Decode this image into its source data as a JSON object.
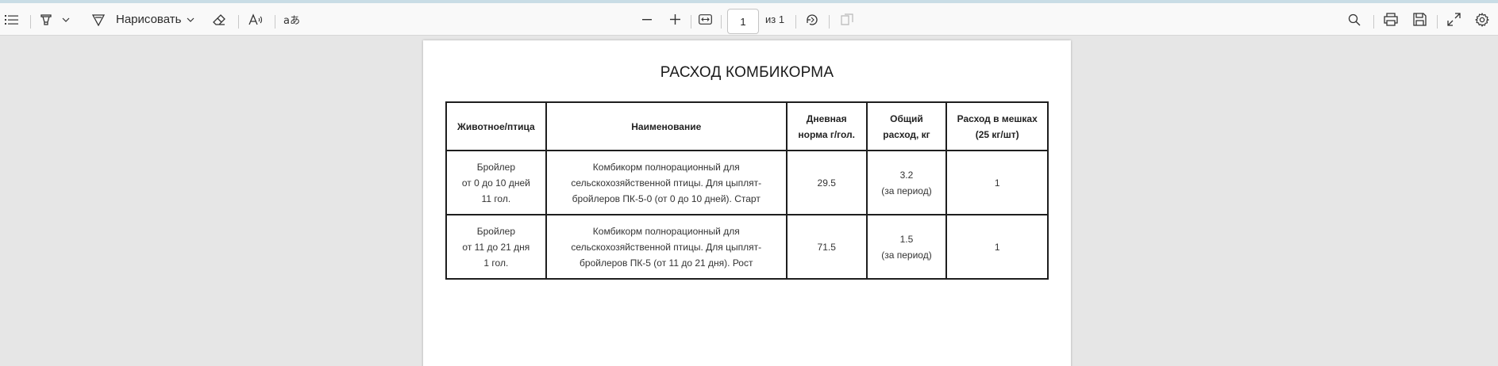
{
  "toolbar": {
    "draw_label": "Нарисовать",
    "page_number": "1",
    "page_of": "из 1"
  },
  "document": {
    "title": "РАСХОД КОМБИКОРМА",
    "headers": [
      [
        "Животное/птица"
      ],
      [
        "Наименование"
      ],
      [
        "Дневная",
        "норма г/гол."
      ],
      [
        "Общий",
        "расход, кг"
      ],
      [
        "Расход в мешках",
        "(25 кг/шт)"
      ]
    ],
    "rows": [
      [
        [
          "Бройлер",
          "от 0 до 10 дней",
          "11 гол."
        ],
        [
          "Комбикорм полнорационный для",
          "сельскохозяйственной птицы. Для цыплят-",
          "бройлеров ПК-5-0 (от 0 до 10 дней). Старт"
        ],
        [
          "29.5"
        ],
        [
          "3.2",
          "(за период)"
        ],
        [
          "1"
        ]
      ],
      [
        [
          "Бройлер",
          "от 11 до 21 дня",
          "1 гол."
        ],
        [
          "Комбикорм полнорационный для",
          "сельскохозяйственной птицы. Для цыплят-",
          "бройлеров ПК-5 (от 11 до 21 дня). Рост"
        ],
        [
          "71.5"
        ],
        [
          "1.5",
          "(за период)"
        ],
        [
          "1"
        ]
      ]
    ]
  }
}
